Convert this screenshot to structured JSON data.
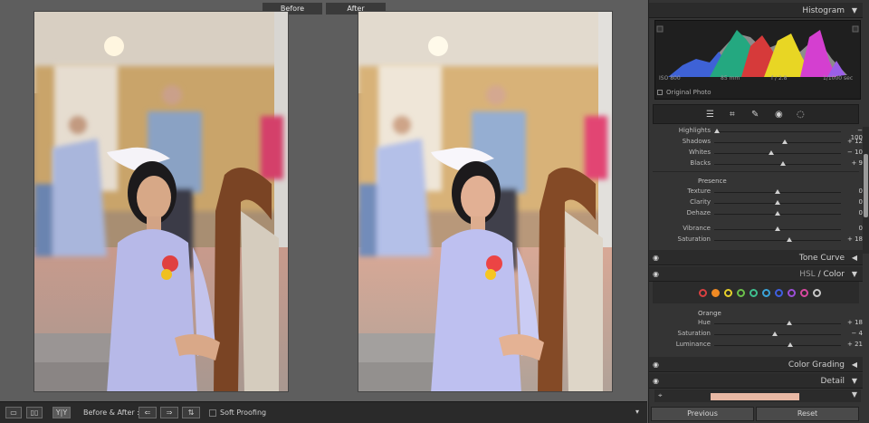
{
  "compare": {
    "before_label": "Before",
    "after_label": "After"
  },
  "toolbar": {
    "view_loupe_icon": "single-view-icon",
    "view_side_icon": "side-by-side-icon",
    "view_yy_label": "Y|Y",
    "before_after_label": "Before & After :",
    "swap_icon": "swap-arrows-icon",
    "copy_left_icon": "copy-after-to-before-icon",
    "copy_right_icon": "copy-before-to-after-icon",
    "soft_proofing_label": "Soft Proofing"
  },
  "panel": {
    "histogram_title": "Histogram",
    "hist_info": {
      "iso": "ISO 800",
      "focal": "85 mm",
      "aperture": "f / 2.8",
      "shutter": "1/1000 sec"
    },
    "original_photo_label": "Original Photo",
    "tools": [
      "edit-sliders-icon",
      "crop-icon",
      "healing-brush-icon",
      "red-eye-icon",
      "masking-icon"
    ],
    "basic_sliders": [
      {
        "label": "Highlights",
        "value": "− 100",
        "pos": 0.02
      },
      {
        "label": "Shadows",
        "value": "+ 12",
        "pos": 0.56
      },
      {
        "label": "Whites",
        "value": "− 10",
        "pos": 0.45
      },
      {
        "label": "Blacks",
        "value": "+ 9",
        "pos": 0.54
      }
    ],
    "presence_title": "Presence",
    "presence_sliders": [
      {
        "label": "Texture",
        "value": "0",
        "pos": 0.5
      },
      {
        "label": "Clarity",
        "value": "0",
        "pos": 0.5
      },
      {
        "label": "Dehaze",
        "value": "0",
        "pos": 0.5
      }
    ],
    "vibrance_sliders": [
      {
        "label": "Vibrance",
        "value": "0",
        "pos": 0.5
      },
      {
        "label": "Saturation",
        "value": "+ 18",
        "pos": 0.59
      }
    ],
    "tone_curve_title": "Tone Curve",
    "hsl_title": "HSL",
    "hsl_sep": "/",
    "color_title": "Color",
    "color_swatches": [
      "#d94040",
      "#f08a24",
      "#e6d02a",
      "#6cc04a",
      "#3fbf8f",
      "#3aa3d9",
      "#3f5fe0",
      "#9b4fd8",
      "#d8489f",
      "#c8c8c8"
    ],
    "orange_title": "Orange",
    "orange_sliders": [
      {
        "label": "Hue",
        "value": "+ 18",
        "pos": 0.59
      },
      {
        "label": "Saturation",
        "value": "− 4",
        "pos": 0.48
      },
      {
        "label": "Luminance",
        "value": "+ 21",
        "pos": 0.6
      }
    ],
    "color_grading_title": "Color Grading",
    "detail_title": "Detail",
    "previous_label": "Previous",
    "reset_label": "Reset"
  }
}
